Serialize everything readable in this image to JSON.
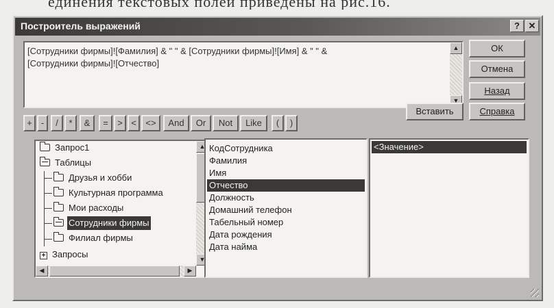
{
  "page_caption": "единения текстовых полей приведены на рис.16.",
  "dialog": {
    "title": "Построитель выражений",
    "help_icon_label": "?",
    "close_icon_label": "✕"
  },
  "expression": {
    "line1": "[Сотрудники фирмы]![Фамилия] & \" \" & [Сотрудники фирмы]![Имя] & \" \" &",
    "line2": "[Сотрудники фирмы]![Отчество]"
  },
  "buttons": {
    "ok": "ОК",
    "cancel": "Отмена",
    "back": "Назад",
    "help": "Справка",
    "paste": "Вставить"
  },
  "operators": [
    "+",
    "-",
    "/",
    "*",
    "&",
    "=",
    ">",
    "<",
    "<>",
    "And",
    "Or",
    "Not",
    "Like",
    "(",
    ")"
  ],
  "tree": {
    "items": [
      "Запрос1",
      "Таблицы",
      "Друзья и хобби",
      "Культурная программа",
      "Мои расходы",
      "Сотрудники фирмы",
      "Филиал фирмы",
      "Запросы"
    ],
    "expand_symbol": "+",
    "selected": "Сотрудники фирмы"
  },
  "fields": {
    "items": [
      "КодСотрудника",
      "Фамилия",
      "Имя",
      "Отчество",
      "Должность",
      "Домашний телефон",
      "Табельный номер",
      "Дата рождения",
      "Дата найма"
    ],
    "selected": "Отчество"
  },
  "values": {
    "items": [
      "<Значение>"
    ]
  }
}
